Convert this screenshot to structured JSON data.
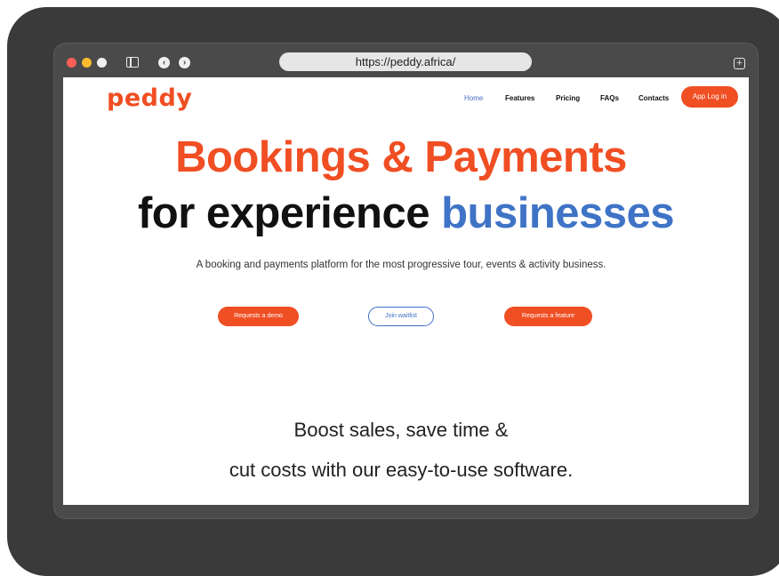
{
  "browser": {
    "url": "https://peddy.africa/",
    "icons": {
      "close": "close-dot",
      "minimize": "minimize-dot",
      "maximize": "maximize-dot",
      "sidebar": "sidebar-toggle-icon",
      "back": "chevron-left-icon",
      "forward": "chevron-right-icon",
      "new_tab": "new-tab-icon"
    }
  },
  "site": {
    "logo": "peddy",
    "nav": {
      "home": "Home",
      "features": "Features",
      "pricing": "Pricing",
      "faqs": "FAQs",
      "contacts": "Contacts",
      "app_login": "App Log in"
    },
    "hero": {
      "line1": "Bookings & Payments",
      "line2_prefix": "for experience ",
      "line2_accent": "businesses",
      "tagline": "A booking and payments platform for the most progressive tour, events & activity business."
    },
    "cta": {
      "demo": "Requests a demo",
      "waitlist": "Join waitlist",
      "feature": "Requests a feature"
    },
    "section": {
      "line1": "Boost sales, save time &",
      "line2": "cut costs with our easy-to-use software."
    }
  },
  "colors": {
    "brand_orange": "#f04e23",
    "accent_blue": "#3f73c6",
    "device_frame": "#3a3a3a"
  }
}
